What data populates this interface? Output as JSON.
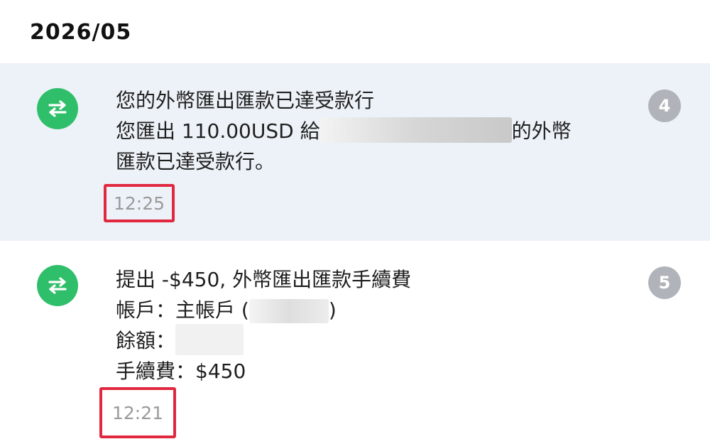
{
  "header": {
    "month": "2026/05"
  },
  "notifications": [
    {
      "icon": "transfer-arrows-icon",
      "line1": "您的外幣匯出匯款已達受款行",
      "line2_prefix": "您匯出 110.00USD 給",
      "line2_suffix": "的外幣",
      "line3": "匯款已達受款行。",
      "time": "12:25",
      "badge": "4",
      "highlighted": true
    },
    {
      "icon": "transfer-arrows-icon",
      "line1": "提出 -$450, 外幣匯出匯款手續費",
      "line2_prefix": "帳戶：主帳戶 (",
      "line2_suffix": ")",
      "line3_label": "餘額：",
      "line4": "手續費：$450",
      "time": "12:21",
      "badge": "5",
      "highlighted": false
    }
  ],
  "colors": {
    "icon_bg": "#2fbf6a",
    "highlight_bg": "#edf2f8",
    "badge_bg": "#b1b3bb",
    "annotation_border": "#e0293f",
    "time_text": "#9a9a9a"
  }
}
